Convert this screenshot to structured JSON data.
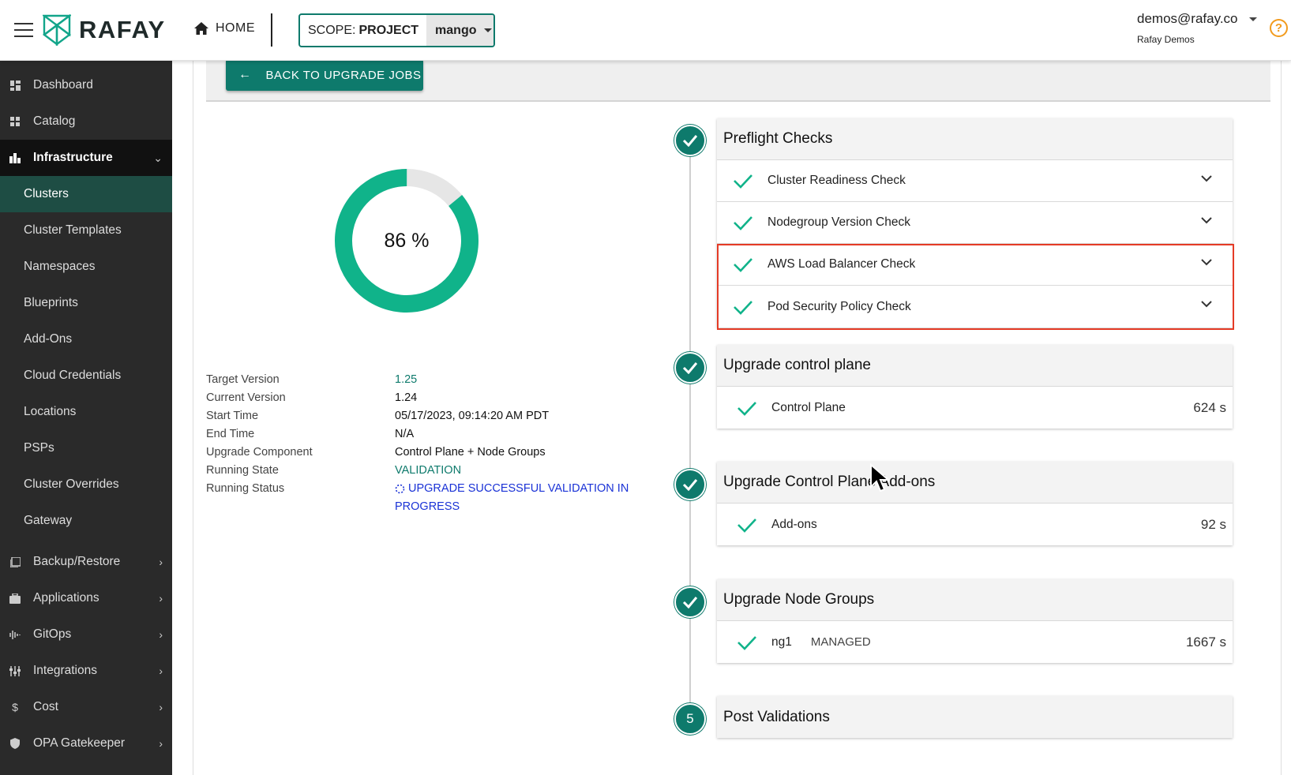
{
  "header": {
    "brand": "RAFAY",
    "home_label": "HOME",
    "scope_label": "SCOPE:",
    "scope_type": "PROJECT",
    "scope_value": "mango",
    "user_email": "demos@rafay.co",
    "user_org": "Rafay Demos",
    "help_icon": "?"
  },
  "sidebar": {
    "items": [
      {
        "label": "Dashboard",
        "icon": "dashboard-icon"
      },
      {
        "label": "Catalog",
        "icon": "catalog-icon"
      },
      {
        "label": "Infrastructure",
        "icon": "infrastructure-icon",
        "expanded": true
      },
      {
        "label": "Clusters",
        "active": true
      },
      {
        "label": "Cluster Templates"
      },
      {
        "label": "Namespaces"
      },
      {
        "label": "Blueprints"
      },
      {
        "label": "Add-Ons"
      },
      {
        "label": "Cloud Credentials"
      },
      {
        "label": "Locations"
      },
      {
        "label": "PSPs"
      },
      {
        "label": "Cluster Overrides"
      },
      {
        "label": "Gateway"
      },
      {
        "label": "Backup/Restore",
        "icon": "backup-icon"
      },
      {
        "label": "Applications",
        "icon": "briefcase-icon"
      },
      {
        "label": "GitOps",
        "icon": "gitops-icon"
      },
      {
        "label": "Integrations",
        "icon": "integrations-icon"
      },
      {
        "label": "Cost",
        "icon": "dollar-icon"
      },
      {
        "label": "OPA Gatekeeper",
        "icon": "shield-icon"
      }
    ]
  },
  "main": {
    "back_label": "BACK TO UPGRADE JOBS",
    "progress_percent": 86,
    "progress_label": "86 %",
    "details": {
      "target_version_label": "Target Version",
      "target_version": "1.25",
      "current_version_label": "Current Version",
      "current_version": "1.24",
      "start_time_label": "Start Time",
      "start_time": "05/17/2023, 09:14:20 AM PDT",
      "end_time_label": "End Time",
      "end_time": "N/A",
      "upgrade_component_label": "Upgrade Component",
      "upgrade_component": "Control Plane + Node Groups",
      "running_state_label": "Running State",
      "running_state": "VALIDATION",
      "running_status_label": "Running Status",
      "running_status_line1": "UPGRADE SUCCESSFUL VALIDATION IN",
      "running_status_line2": "PROGRESS"
    },
    "steps": [
      {
        "title": "Preflight Checks",
        "status": "done",
        "rows": [
          {
            "label": "Cluster Readiness Check"
          },
          {
            "label": "Nodegroup Version Check"
          },
          {
            "label": "AWS Load Balancer Check"
          },
          {
            "label": "Pod Security Policy Check"
          }
        ]
      },
      {
        "title": "Upgrade control plane",
        "status": "done",
        "rows": [
          {
            "label": "Control Plane",
            "duration": "624 s"
          }
        ]
      },
      {
        "title": "Upgrade Control Plane Add-ons",
        "status": "done",
        "rows": [
          {
            "label": "Add-ons",
            "duration": "92 s"
          }
        ]
      },
      {
        "title": "Upgrade Node Groups",
        "status": "done",
        "rows": [
          {
            "label": "ng1",
            "tag": "MANAGED",
            "duration": "1667 s"
          }
        ]
      },
      {
        "title": "Post Validations",
        "status": "pending",
        "number": "5"
      }
    ]
  },
  "colors": {
    "accent": "#0e7a6c",
    "progress": "#10b38a",
    "highlight": "#e53b26",
    "status_blue": "#1a32d6"
  }
}
